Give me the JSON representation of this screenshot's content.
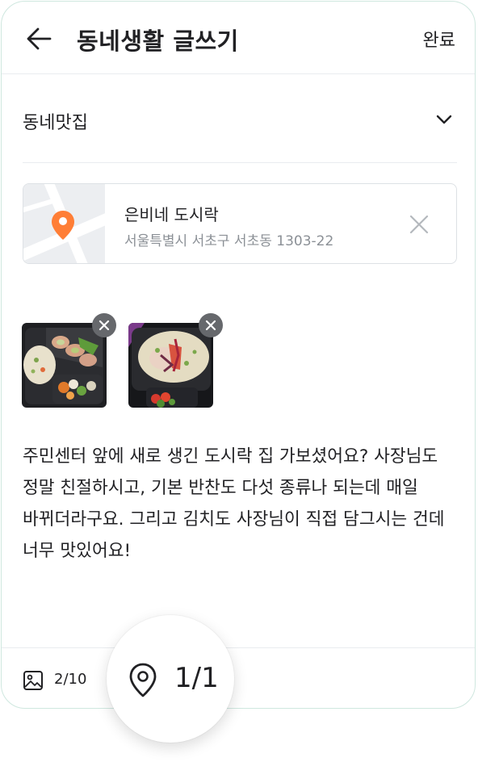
{
  "header": {
    "title": "동네생활 글쓰기",
    "done_label": "완료",
    "back_icon": "arrow-left-icon"
  },
  "category": {
    "selected": "동네맛집",
    "chevron_icon": "chevron-down-icon"
  },
  "location": {
    "name": "은비네 도시락",
    "address": "서울특별시 서초구 서초동 1303-22",
    "pin_color": "#ff7e36",
    "remove_icon": "close-icon"
  },
  "photos": [
    {
      "alt": "food photo 1",
      "remove_icon": "close-icon"
    },
    {
      "alt": "food photo 2",
      "remove_icon": "close-icon"
    }
  ],
  "body": {
    "text": "주민센터 앞에 새로 생긴 도시락 집 가보셨어요? 사장님도 정말 친절하시고, 기본 반찬도 다섯 종류나 되는데 매일 바뀌더라구요. 그리고 김치도 사장님이 직접 담그시는 건데 너무 맛있어요!"
  },
  "toolbar": {
    "photo_count": "2/10",
    "photo_icon": "image-icon",
    "location_count": "1/1",
    "location_icon": "map-pin-icon"
  }
}
